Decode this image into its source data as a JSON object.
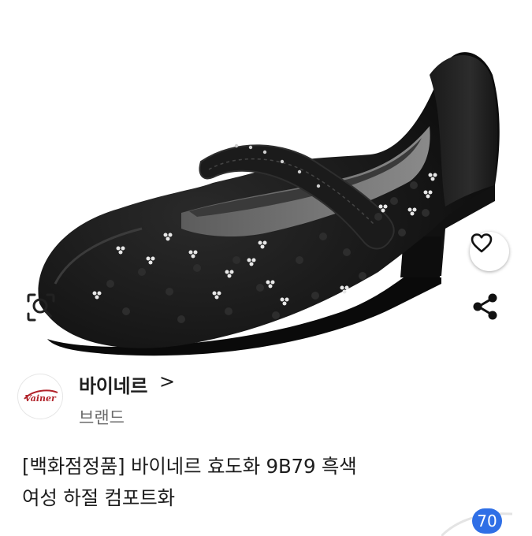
{
  "product": {
    "image_alt_icon": "shoe-photo",
    "actions": {
      "lens": "search-lens-icon",
      "wishlist": "heart-icon",
      "share": "share-icon"
    },
    "brand": {
      "logo_text": "Vainer",
      "name": "바이네르",
      "chevron": ">",
      "type_label": "브랜드"
    },
    "title_line1": "[백화점정품] 바이네르 효도화 9B79 흑색",
    "title_line2": "여성 하절 컴포트화",
    "badge_count": "70"
  },
  "colors": {
    "badge": "#2f6fe6",
    "logo_red": "#b1232a",
    "text": "#1d1d1d",
    "subtext": "#6b6b6b"
  }
}
